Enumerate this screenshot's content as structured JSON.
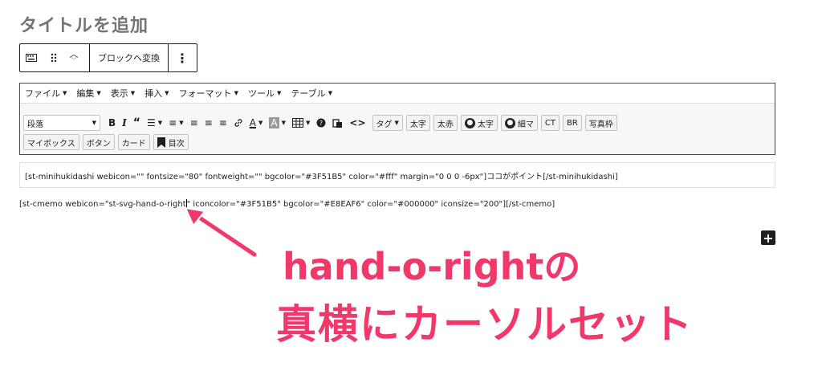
{
  "page_title": "タイトルを追加",
  "block_toolbar": {
    "transform_label": "ブロックへ変換",
    "more_label": "⋮"
  },
  "menubar": [
    "ファイル",
    "編集",
    "表示",
    "挿入",
    "フォーマット",
    "ツール",
    "テーブル"
  ],
  "format_select": "段落",
  "quick_buttons_row1": [
    "タグ",
    "太字",
    "太赤"
  ],
  "avatar_buttons": [
    "太字",
    "細マ"
  ],
  "quick_buttons_row1_end": [
    "CT",
    "BR",
    "写真枠"
  ],
  "quick_buttons_row2": [
    "マイボックス",
    "ボタン",
    "カード"
  ],
  "toc_button": "目次",
  "code_box_text": "[st-minihukidashi webicon=\"\" fontsize=\"80\" fontweight=\"\" bgcolor=\"#3F51B5\" color=\"#fff\" margin=\"0 0 0 -6px\"]ココがポイント[/st-minihukidashi]",
  "code_line_before_cursor": "[st-cmemo webicon=\"st-svg-hand-o-right",
  "code_line_after_cursor": "\" iconcolor=\"#3F51B5\" bgcolor=\"#E8EAF6\" color=\"#000000\" iconsize=\"200\"][/st-cmemo]",
  "annotation_line1": "hand-o-rightの",
  "annotation_line2": "真横にカーソルセット",
  "colors": {
    "annotation": "#f0386b"
  },
  "icons": [
    "keyboard-icon",
    "drag-handle-icon",
    "move-up-icon",
    "move-down-icon",
    "bold-icon",
    "italic-icon",
    "blockquote-icon",
    "bullet-list-icon",
    "numbered-list-icon",
    "align-left-icon",
    "align-center-icon",
    "align-right-icon",
    "link-icon",
    "text-color-icon",
    "background-color-icon",
    "table-icon",
    "help-icon",
    "paste-icon",
    "code-icon",
    "bookmark-icon",
    "plus-icon",
    "arrow-icon"
  ]
}
